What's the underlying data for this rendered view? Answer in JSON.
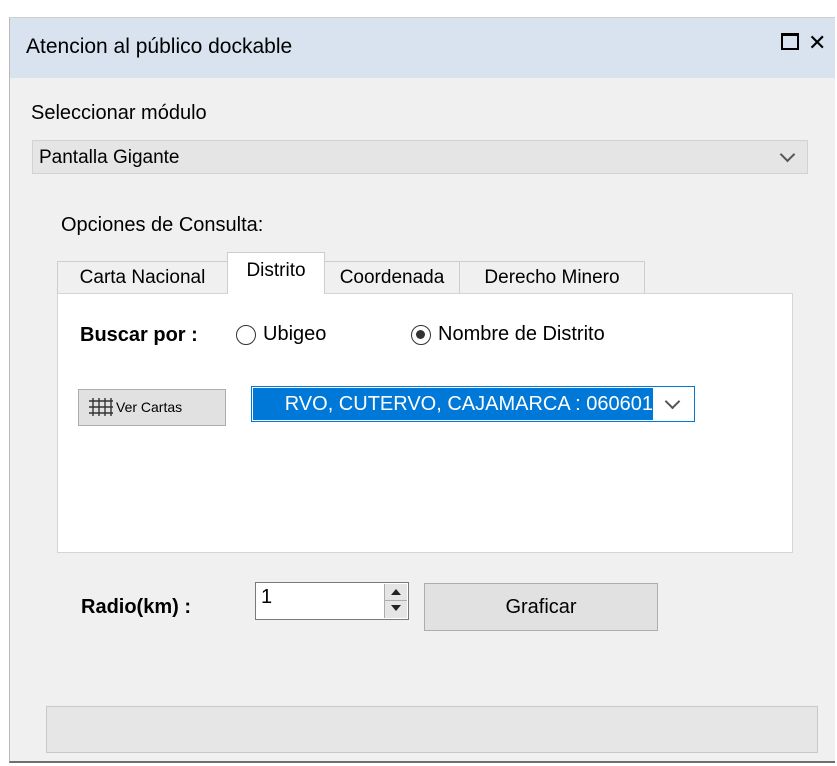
{
  "window": {
    "title": "Atencion al público dockable",
    "maximize_icon": "maximize-icon",
    "close_icon": "close-icon",
    "close_glyph": "✕"
  },
  "modulo": {
    "label": "Seleccionar módulo",
    "selected": "Pantalla Gigante"
  },
  "opciones": {
    "label": "Opciones de Consulta:"
  },
  "tabs": [
    {
      "label": "Carta Nacional",
      "active": false
    },
    {
      "label": "Distrito",
      "active": true
    },
    {
      "label": "Coordenada",
      "active": false
    },
    {
      "label": "Derecho Minero",
      "active": false
    }
  ],
  "distrito_tab": {
    "buscar_label": "Buscar por :",
    "radio_ubigeo": "Ubigeo",
    "radio_nombre": "Nombre de Distrito",
    "selected_radio": "Nombre de Distrito",
    "ver_cartas_label": "Ver Cartas",
    "distrito_value": "RVO, CUTERVO, CAJAMARCA : 060601"
  },
  "radio": {
    "label": "Radio(km) :",
    "value": "1"
  },
  "graficar_label": "Graficar",
  "colors": {
    "titlebar": "#d9e3f0",
    "selection": "#0078d7",
    "panel": "#f0f0f0"
  }
}
